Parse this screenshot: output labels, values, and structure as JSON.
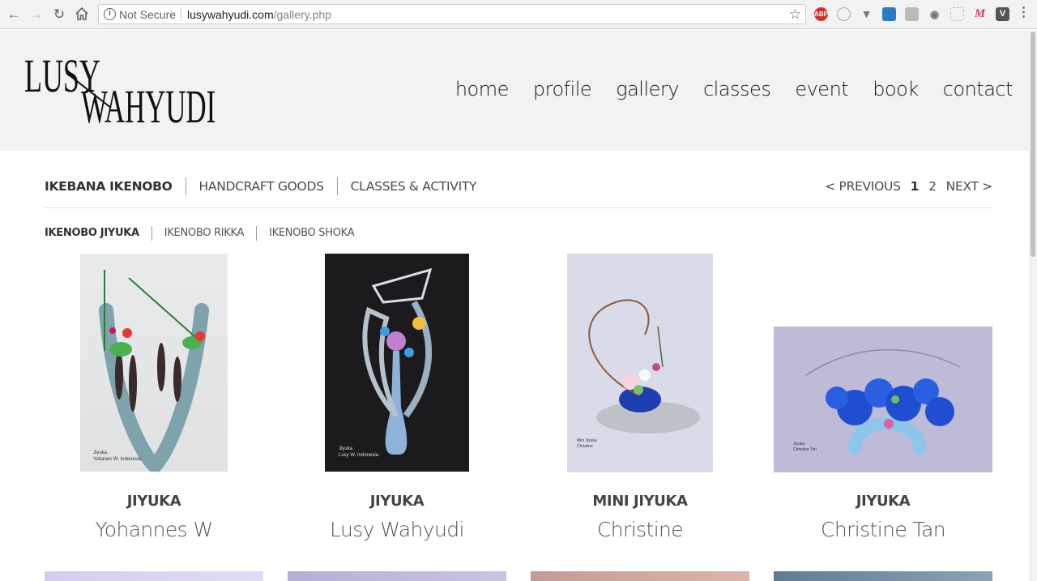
{
  "browser": {
    "security_label": "Not Secure",
    "url_host": "lusywahyudi.com",
    "url_path": "/gallery.php",
    "extensions": [
      "ABP",
      "M",
      "V"
    ]
  },
  "site": {
    "logo_line1": "LUSY",
    "logo_line2": "WAHYUDI",
    "nav": [
      "home",
      "profile",
      "gallery",
      "classes",
      "event",
      "book",
      "contact"
    ]
  },
  "filters": {
    "categories": [
      "IKEBANA IKENOBO",
      "HANDCRAFT GOODS",
      "CLASSES & ACTIVITY"
    ],
    "active_category": "IKEBANA IKENOBO",
    "subcategories": [
      "IKENOBO JIYUKA",
      "IKENOBO RIKKA",
      "IKENOBO SHOKA"
    ],
    "active_subcategory": "IKENOBO JIYUKA"
  },
  "pager": {
    "previous": "< PREVIOUS",
    "pages": [
      "1",
      "2"
    ],
    "current": "1",
    "next": "NEXT >"
  },
  "gallery": [
    {
      "category": "JIYUKA",
      "artist": "Yohannes W",
      "caption1": "Jiyuka",
      "caption2": "Yohanes W. Indonesia"
    },
    {
      "category": "JIYUKA",
      "artist": "Lusy Wahyudi",
      "caption1": "Jiyuka",
      "caption2": "Lusy W. Indonesia"
    },
    {
      "category": "MINI JIYUKA",
      "artist": "Christine",
      "caption1": "Mini Jiyuka",
      "caption2": "Christine"
    },
    {
      "category": "JIYUKA",
      "artist": "Christine Tan",
      "caption1": "Jiyuka",
      "caption2": "Christine Tan"
    }
  ],
  "colors": {
    "header_bg": "#f2f2f2",
    "text_dark": "#333333",
    "text_mid": "#555555"
  }
}
